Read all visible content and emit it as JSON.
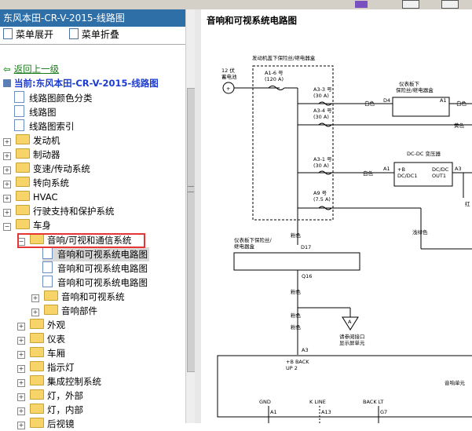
{
  "window": {
    "title": "东风本田-CR-V-2015-线路图"
  },
  "menu": {
    "expand": "菜单展开",
    "collapse": "菜单折叠"
  },
  "nav": {
    "back": "返回上一级",
    "current": "当前:东风本田-CR-V-2015-线路图"
  },
  "tree": {
    "doc_color": "线路图颜色分类",
    "doc_diagram": "线路图",
    "doc_index": "线路图索引",
    "engine": "发动机",
    "brake": "制动器",
    "transmission": "变速/传动系统",
    "steering": "转向系统",
    "hvac": "HVAC",
    "support": "行驶支持和保护系统",
    "body": "车身",
    "audio": "音响/可视和通信系统",
    "audio_d1": "音响和可视系统电路图",
    "audio_d2": "音响和可视系统电路图",
    "audio_d3": "音响和可视系统电路图",
    "audio_sys": "音响和可视系统",
    "audio_parts": "音响部件",
    "exterior": "外观",
    "gauges": "仪表",
    "cabin": "车厢",
    "indicator": "指示灯",
    "integrated": "集成控制系统",
    "lights_ext": "灯，外部",
    "lights_int": "灯，内部",
    "mirror": "后视镜"
  },
  "diagram": {
    "title": "音响和可视系统电路图",
    "engine_box": "发动机盖下保险丝/继电器盒",
    "battery": [
      "12 伏",
      "蓄电池"
    ],
    "a16": [
      "A1-6 号",
      "(120 A)"
    ],
    "a33": [
      "A3-3 号",
      "(30 A)"
    ],
    "a34": [
      "A3-4 号",
      "(30 A)"
    ],
    "a31": [
      "A3-1 号",
      "(30 A)"
    ],
    "a9": [
      "A9 号",
      "(7.5 A)"
    ],
    "white": "白色",
    "yellow": "黄色",
    "red": "红色",
    "pink": "粉色",
    "light_green": "浅绿色",
    "dash_box_right": [
      "仪表板下",
      "保险丝/继电器盒"
    ],
    "dash_box_left": [
      "仪表板下保险丝/",
      "继电器盒"
    ],
    "d4": "D4",
    "a1": "A1",
    "a3": "A3",
    "dcdc": "DC-DC 变压器",
    "dcdc_in": [
      "+B",
      "DC/DC1"
    ],
    "dcdc_out": [
      "DC/DC",
      "OUT1"
    ],
    "d17": "D17",
    "q16": "Q16",
    "ground_a": "A",
    "ground_note": [
      "请参阅接口",
      "显示屏单元"
    ],
    "unit_a3": "A3",
    "back_up": [
      "+B BACK",
      "UP 2"
    ],
    "audio_unit": "音响单元",
    "gnd": "GND",
    "kline": "K LINE",
    "backlt": "BACK LT",
    "pin_a1": "A1",
    "pin_a13": "A13",
    "pin_g7": "G7",
    "right_edge": "红"
  }
}
